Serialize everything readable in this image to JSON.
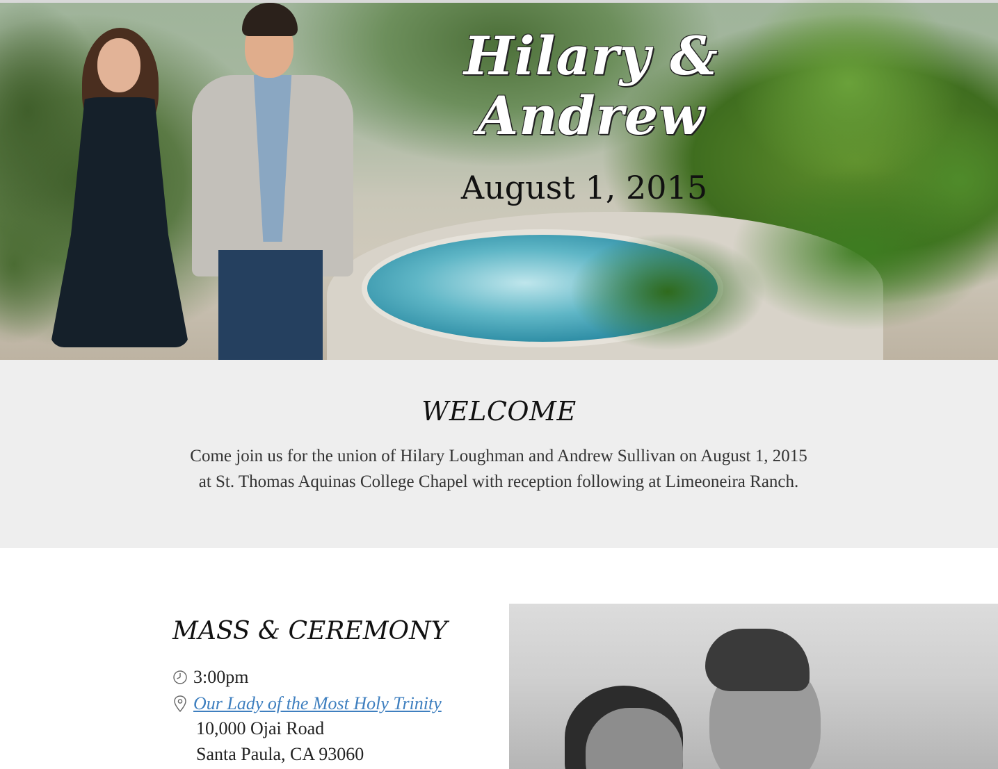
{
  "hero": {
    "names_line1": "Hilary &",
    "names_line2": "Andrew",
    "date": "August 1, 2015"
  },
  "welcome": {
    "title": "WELCOME",
    "text": "Come join us for the union of Hilary Loughman and Andrew Sullivan on August 1, 2015 at St. Thomas Aquinas College Chapel with reception following at Limeoneira Ranch."
  },
  "ceremony": {
    "title": "MASS & CEREMONY",
    "time": "3:00pm",
    "venue_link": "Our Lady of the Most Holy Trinity",
    "address_line1": "10,000 Ojai Road",
    "address_line2": "Santa Paula, CA 93060",
    "icons": {
      "time": "clock-icon",
      "location": "map-pin-icon"
    }
  },
  "colors": {
    "welcome_bg": "#eeeeee",
    "link": "#3e7fbf"
  }
}
